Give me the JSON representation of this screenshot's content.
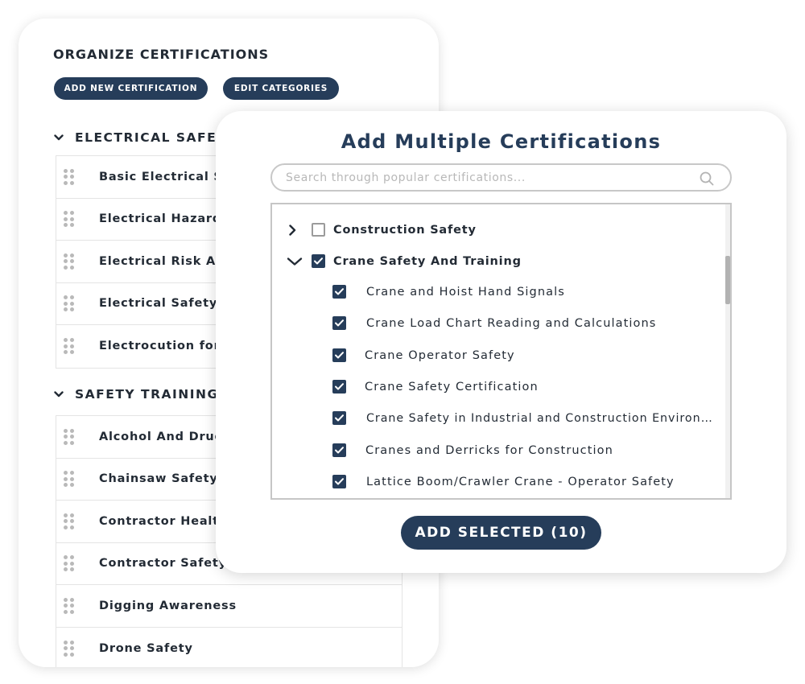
{
  "organize": {
    "title": "ORGANIZE CERTIFICATIONS",
    "add_button": "ADD NEW CERTIFICATION",
    "edit_button": "EDIT CATEGORIES",
    "categories": [
      {
        "name": "ELECTRICAL SAFETY",
        "items": [
          "Basic Electrical Sa",
          "Electrical Hazards",
          "Electrical Risk Ass",
          "Electrical Safety T",
          "Electrocution for C"
        ]
      },
      {
        "name": "SAFETY TRAINING",
        "items": [
          "Alcohol And Drug A",
          "Chainsaw Safety C",
          "Contractor Health",
          "Contractor Safety",
          "Digging Awareness",
          "Drone Safety"
        ]
      }
    ]
  },
  "modal": {
    "title": "Add Multiple Certifications",
    "search_placeholder": "Search through popular certifications...",
    "tree": [
      {
        "label": "Construction Safety",
        "expanded": false,
        "checked": false,
        "children": []
      },
      {
        "label": "Crane Safety And Training",
        "expanded": true,
        "checked": true,
        "children": [
          {
            "label": "Crane and Hoist Hand Signals",
            "checked": true
          },
          {
            "label": "Crane Load Chart Reading and Calculations",
            "checked": true
          },
          {
            "label": "Crane Operator Safety",
            "checked": true
          },
          {
            "label": "Crane Safety Certification",
            "checked": true
          },
          {
            "label": "Crane Safety in Industrial and Construction Environ…",
            "checked": true
          },
          {
            "label": "Cranes and Derricks for Construction",
            "checked": true
          },
          {
            "label": "Lattice Boom/Crawler Crane - Operator Safety",
            "checked": true
          }
        ]
      }
    ],
    "add_selected_button": "ADD SELECTED (10)"
  },
  "colors": {
    "navy": "#263d5a",
    "text": "#232b35",
    "border": "#c6c6c6",
    "grip": "#b9b9b9"
  },
  "icons": {
    "search": "magnifier-icon",
    "drag": "drag-handle-icon",
    "expand": "chevron-right-icon",
    "collapse": "chevron-down-icon",
    "check": "checkmark-icon"
  }
}
